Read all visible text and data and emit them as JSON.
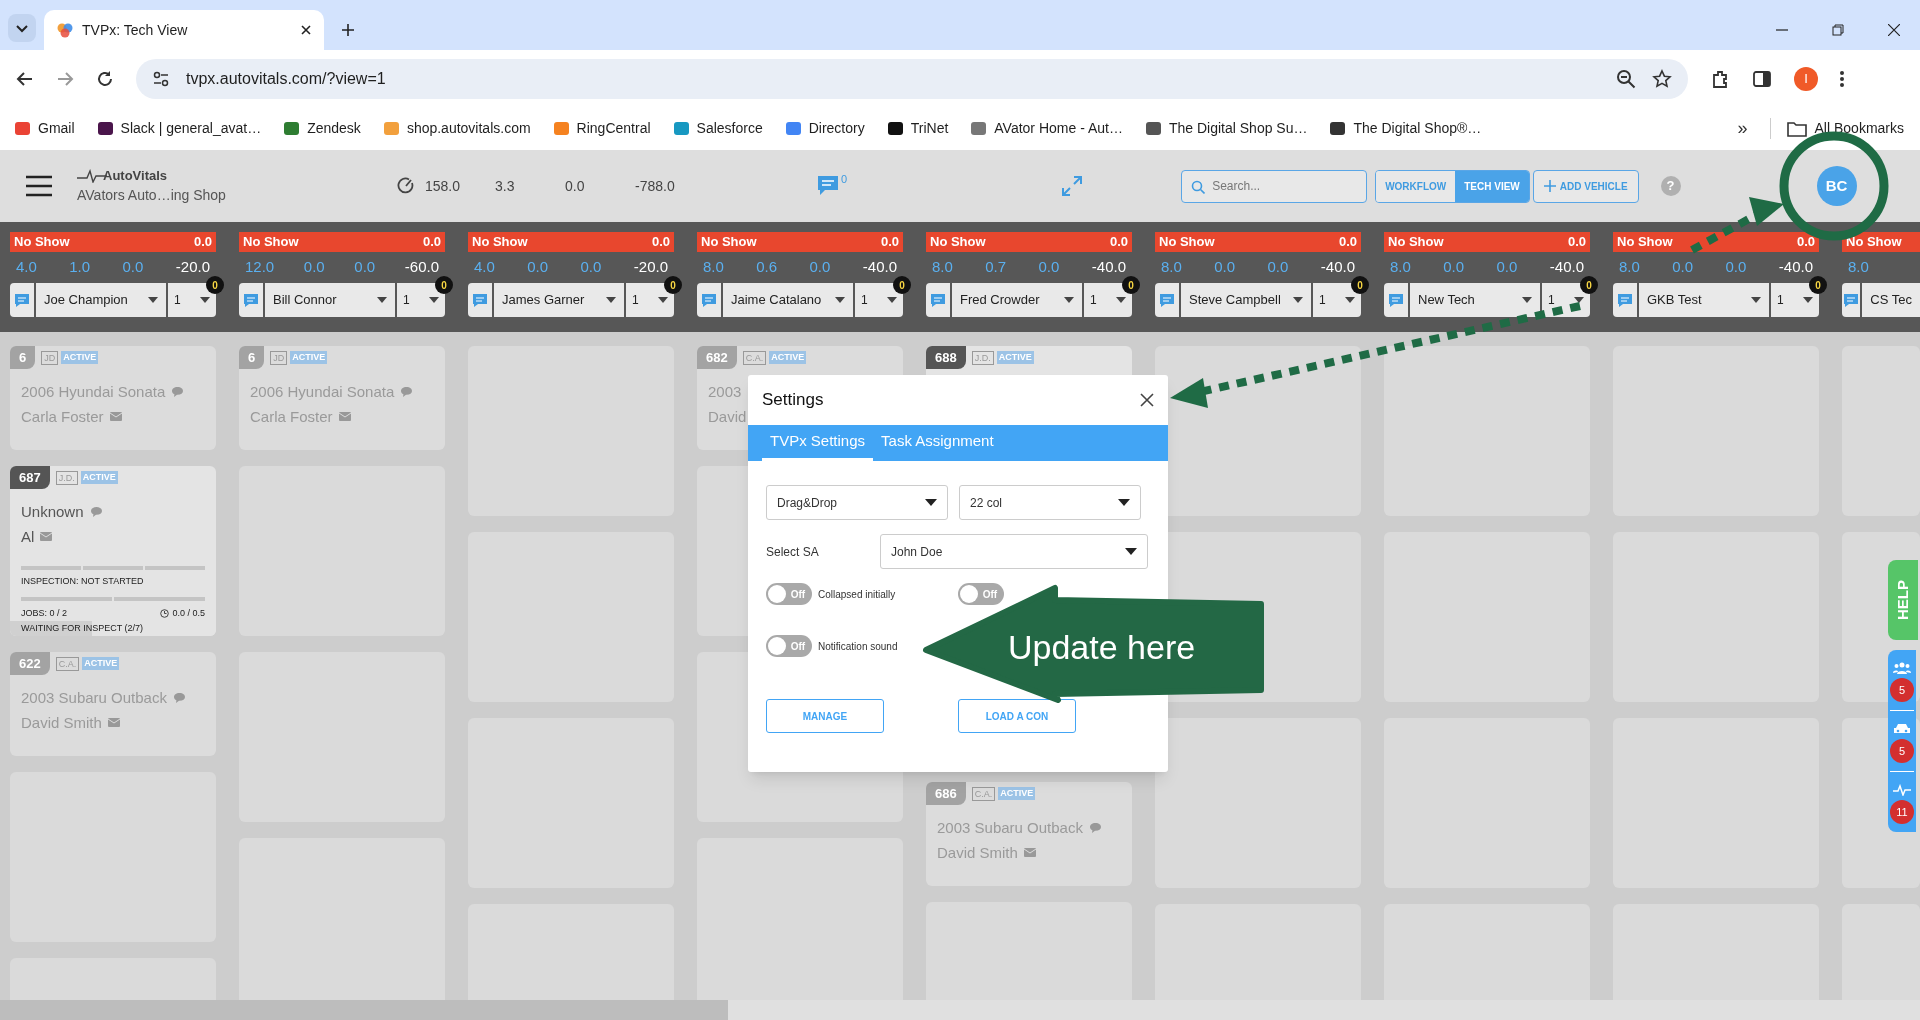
{
  "browser": {
    "tabs": [
      {
        "title": "TVPx: Tech View",
        "selected": true
      }
    ],
    "url": "tvpx.autovitals.com/?view=1",
    "profile": "I",
    "bookmarks": [
      {
        "label": "Gmail"
      },
      {
        "label": "Slack | general_avat…"
      },
      {
        "label": "Zendesk"
      },
      {
        "label": "shop.autovitals.com"
      },
      {
        "label": "RingCentral"
      },
      {
        "label": "Salesforce"
      },
      {
        "label": "Directory"
      },
      {
        "label": "TriNet"
      },
      {
        "label": "AVator Home - Aut…"
      },
      {
        "label": "The Digital Shop Su…"
      },
      {
        "label": "The Digital Shop®…"
      }
    ],
    "more": "»",
    "all_bookmarks": "All Bookmarks"
  },
  "header": {
    "logo": "AutoVitals",
    "shop": "AVators Auto…ing Shop",
    "stats": [
      "158.0",
      "3.3",
      "0.0",
      "-788.0"
    ],
    "messages": "0",
    "search": {
      "placeholder": "Search..."
    },
    "views": [
      {
        "label": "WORKFLOW",
        "selected": false
      },
      {
        "label": "TECH VIEW",
        "selected": true
      }
    ],
    "add_vehicle": "ADD VEHICLE",
    "help": "?",
    "avatar": "BC"
  },
  "columns": [
    {
      "status": "No Show",
      "status_value": "0.0",
      "numbers": [
        "4.0",
        "1.0",
        "0.0",
        "-20.0"
      ],
      "tech": "Joe Champion",
      "count": "1",
      "badge": "0",
      "cards": [
        {
          "kind": "basic",
          "number": "6",
          "tag": "JD",
          "status": "ACTIVE",
          "highlighted": false,
          "vehicle": "2006 Hyundai Sonata",
          "customer": "Carla Foster"
        },
        {
          "kind": "detailed",
          "number": "687",
          "tag": "J.D.",
          "status": "ACTIVE",
          "highlighted": true,
          "vehicle": "Unknown",
          "customer": "Al",
          "inspection": "INSPECTION: NOT STARTED",
          "jobs": "JOBS: 0 / 2",
          "time": "0.0 / 0.5",
          "waiting": "WAITING FOR INSPECT (2/7)"
        },
        {
          "kind": "basic",
          "number": "622",
          "tag": "C.A.",
          "status": "ACTIVE",
          "highlighted": false,
          "vehicle": "2003 Subaru Outback",
          "customer": "David Smith"
        }
      ]
    },
    {
      "status": "No Show",
      "status_value": "0.0",
      "numbers": [
        "12.0",
        "0.0",
        "0.0",
        "-60.0"
      ],
      "tech": "Bill Connor",
      "count": "1",
      "badge": "0",
      "cards": [
        {
          "kind": "basic",
          "number": "6",
          "tag": "JD",
          "status": "ACTIVE",
          "highlighted": false,
          "vehicle": "2006 Hyundai Sonata",
          "customer": "Carla Foster"
        }
      ]
    },
    {
      "status": "No Show",
      "status_value": "0.0",
      "numbers": [
        "4.0",
        "0.0",
        "0.0",
        "-20.0"
      ],
      "tech": "James Garner",
      "count": "1",
      "badge": "0"
    },
    {
      "status": "No Show",
      "status_value": "0.0",
      "numbers": [
        "8.0",
        "0.6",
        "0.0",
        "-40.0"
      ],
      "tech": "Jaime Catalano",
      "count": "1",
      "badge": "0",
      "cards": [
        {
          "kind": "cut",
          "number": "682",
          "tag": "C.A.",
          "status": "ACTIVE",
          "highlighted": false,
          "vehicle": "2003",
          "customer": "David"
        }
      ]
    },
    {
      "status": "No Show",
      "status_value": "0.0",
      "numbers": [
        "8.0",
        "0.7",
        "0.0",
        "-40.0"
      ],
      "tech": "Fred Crowder",
      "count": "1",
      "badge": "0",
      "cards": [
        {
          "kind": "covered",
          "number": "688",
          "tag": "J.D.",
          "status": "ACTIVE",
          "highlighted": true
        },
        {
          "kind": "basic",
          "number": "686",
          "tag": "C.A.",
          "status": "ACTIVE",
          "highlighted": false,
          "vehicle": "2003 Subaru Outback",
          "customer": "David Smith"
        }
      ]
    },
    {
      "status": "No Show",
      "status_value": "0.0",
      "numbers": [
        "8.0",
        "0.0",
        "0.0",
        "-40.0"
      ],
      "tech": "Steve Campbell",
      "count": "1",
      "badge": "0"
    },
    {
      "status": "No Show",
      "status_value": "0.0",
      "numbers": [
        "8.0",
        "0.0",
        "0.0",
        "-40.0"
      ],
      "tech": "New Tech",
      "count": "1",
      "badge": "0"
    },
    {
      "status": "No Show",
      "status_value": "0.0",
      "numbers": [
        "8.0",
        "0.0",
        "0.0",
        "-40.0"
      ],
      "tech": "GKB Test",
      "count": "1",
      "badge": "0"
    },
    {
      "status": "No Show",
      "numbers": [
        "8.0"
      ],
      "tech": "CS Tec"
    }
  ],
  "settings": {
    "title": "Settings",
    "tabs": [
      {
        "label": "TVPx Settings",
        "selected": true
      },
      {
        "label": "Task Assignment",
        "selected": false
      }
    ],
    "selects": [
      "Drag&Drop",
      "22 col"
    ],
    "sa_label": "Select SA",
    "sa_value": "John Doe",
    "toggles": [
      {
        "label": "Collapsed initially",
        "on": false,
        "text": "Off"
      },
      {
        "on": false,
        "text": "Off"
      },
      {
        "label": "Notification sound",
        "on": false,
        "text": "Off"
      }
    ],
    "buttons": [
      "MANAGE",
      "LOAD A CON"
    ]
  },
  "side_panel": {
    "help": "HELP",
    "counts": [
      "5",
      "5",
      "11"
    ]
  },
  "annotation": {
    "text": "Update here"
  }
}
